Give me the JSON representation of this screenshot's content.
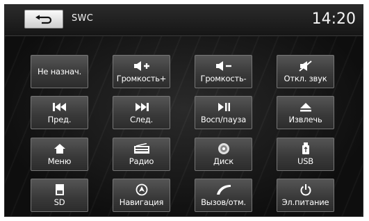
{
  "header": {
    "title": "SWC",
    "time": "14:20",
    "back_icon": "return-arrow-icon"
  },
  "buttons": [
    {
      "label": "Не назнач.",
      "icon": null
    },
    {
      "label": "Громкость+",
      "icon": "volume-up-icon"
    },
    {
      "label": "Громкость-",
      "icon": "volume-down-icon"
    },
    {
      "label": "Откл. звук",
      "icon": "mute-icon"
    },
    {
      "label": "Пред.",
      "icon": "previous-track-icon"
    },
    {
      "label": "След.",
      "icon": "next-track-icon"
    },
    {
      "label": "Восп/пауза",
      "icon": "play-pause-icon"
    },
    {
      "label": "Извлечь",
      "icon": "eject-icon"
    },
    {
      "label": "Меню",
      "icon": "home-icon"
    },
    {
      "label": "Радио",
      "icon": "radio-icon"
    },
    {
      "label": "Диск",
      "icon": "disc-icon"
    },
    {
      "label": "USB",
      "icon": "usb-icon"
    },
    {
      "label": "SD",
      "icon": "sd-card-icon"
    },
    {
      "label": "Навигация",
      "icon": "navigation-icon"
    },
    {
      "label": "Вызов/отм.",
      "icon": "phone-icon"
    },
    {
      "label": "Эл.питание",
      "icon": "power-icon"
    }
  ]
}
